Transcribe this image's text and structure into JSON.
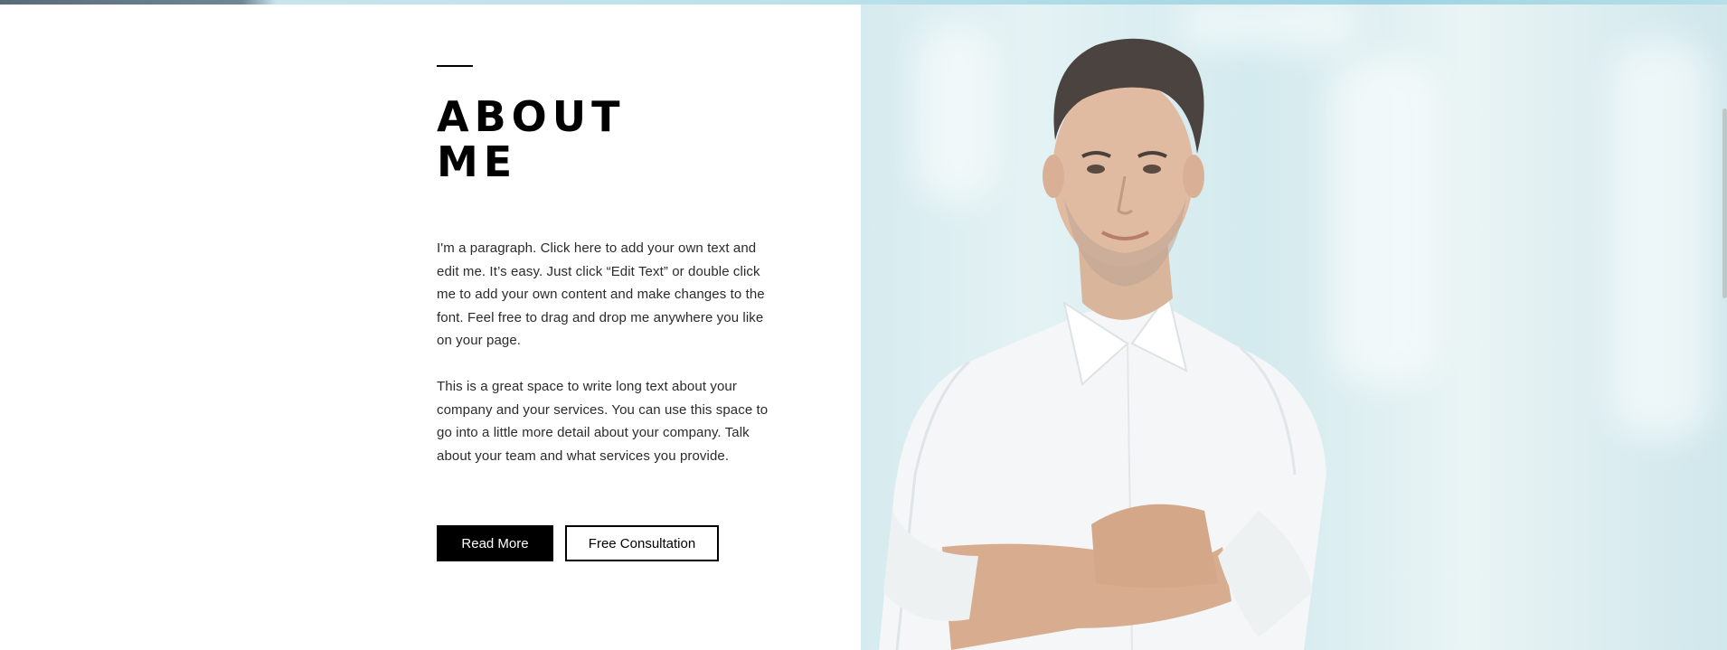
{
  "about": {
    "title_line1": "ABOUT",
    "title_line2": "ME",
    "paragraph1": "I'm a paragraph. Click here to add your own text and edit me. It’s easy. Just click “Edit Text” or double click me to add your own content and make changes to the font. Feel free to drag and drop me anywhere you like on your page.",
    "paragraph2": "This is a great space to write long text about your company and your services. You can use this space to go into a little more detail about your company. Talk about your team and what services you provide."
  },
  "buttons": {
    "read_more": "Read More",
    "free_consultation": "Free Consultation"
  },
  "colors": {
    "text": "#000000",
    "button_primary_bg": "#000000",
    "button_primary_text": "#ffffff",
    "photo_background": "#d6ebef",
    "shirt": "#f4f6f7"
  }
}
